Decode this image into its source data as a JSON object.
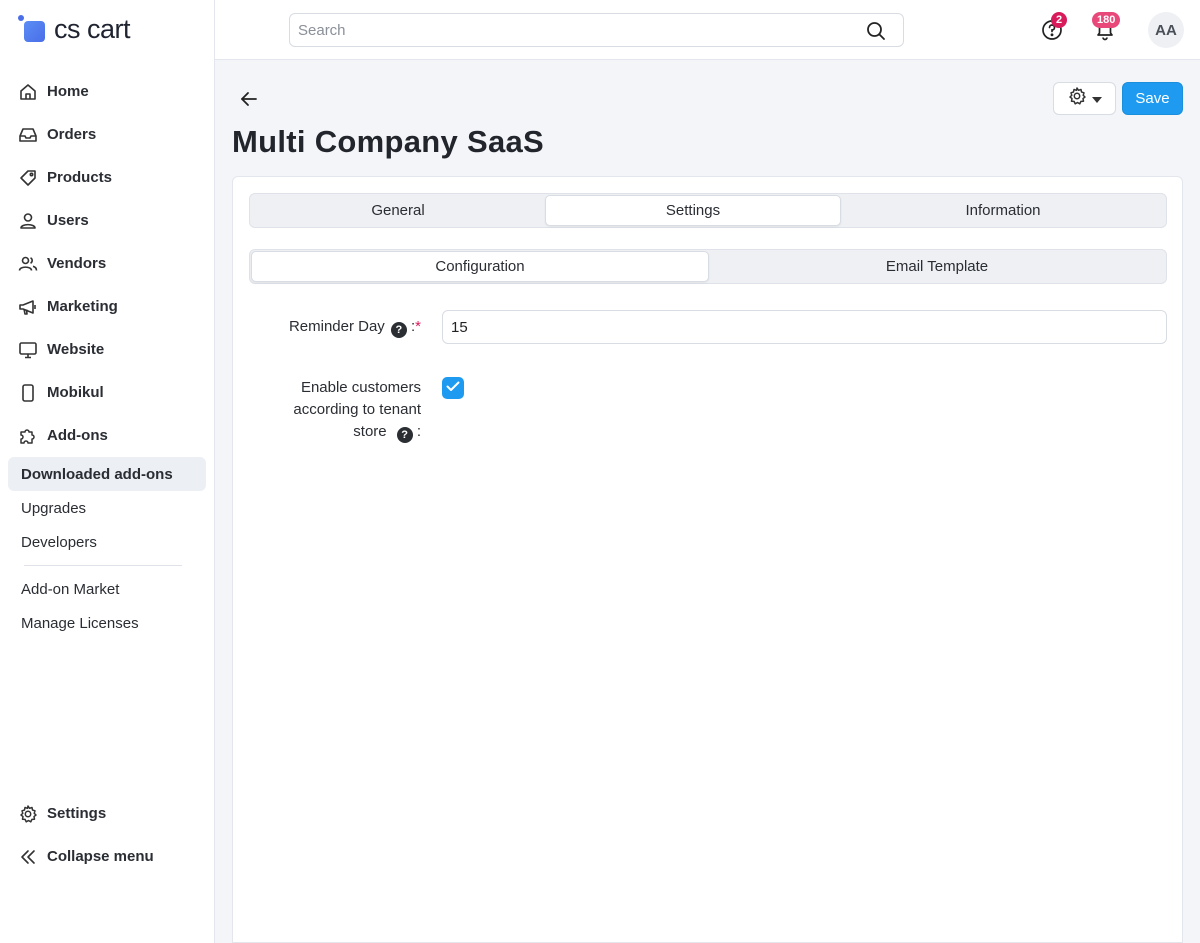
{
  "brand": {
    "name": "cs cart",
    "accent": "#4a6ee8"
  },
  "sidebar": {
    "items": [
      {
        "label": "Home",
        "icon": "home-icon"
      },
      {
        "label": "Orders",
        "icon": "inbox-icon"
      },
      {
        "label": "Products",
        "icon": "tag-icon"
      },
      {
        "label": "Users",
        "icon": "user-icon"
      },
      {
        "label": "Vendors",
        "icon": "users-icon"
      },
      {
        "label": "Marketing",
        "icon": "megaphone-icon"
      },
      {
        "label": "Website",
        "icon": "monitor-icon"
      },
      {
        "label": "Mobikul",
        "icon": "phone-icon"
      },
      {
        "label": "Add-ons",
        "icon": "puzzle-icon"
      }
    ],
    "subitems": [
      {
        "label": "Downloaded add-ons",
        "active": true
      },
      {
        "label": "Upgrades"
      },
      {
        "label": "Developers"
      },
      {
        "label": "Add-on Market"
      },
      {
        "label": "Manage Licenses"
      }
    ],
    "bottom": [
      {
        "label": "Settings",
        "icon": "gear-icon"
      },
      {
        "label": "Collapse menu",
        "icon": "double-chevron-left-icon"
      }
    ]
  },
  "topbar": {
    "search_placeholder": "Search",
    "help_badge": "2",
    "notifications_badge": "180",
    "avatar_initials": "AA"
  },
  "page": {
    "title": "Multi Company SaaS",
    "save_label": "Save"
  },
  "tabs": [
    "General",
    "Settings",
    "Information"
  ],
  "active_tab": "Settings",
  "subtabs": [
    "Configuration",
    "Email Template"
  ],
  "active_subtab": "Configuration",
  "form": {
    "reminder_day_label": "Reminder Day",
    "reminder_day_colon": ":",
    "reminder_day_required": "*",
    "reminder_day_value": "15",
    "enable_label_line1": "Enable customers",
    "enable_label_line2": "according to tenant",
    "enable_label_line3": "store",
    "enable_colon": ":",
    "enable_checked": true
  }
}
